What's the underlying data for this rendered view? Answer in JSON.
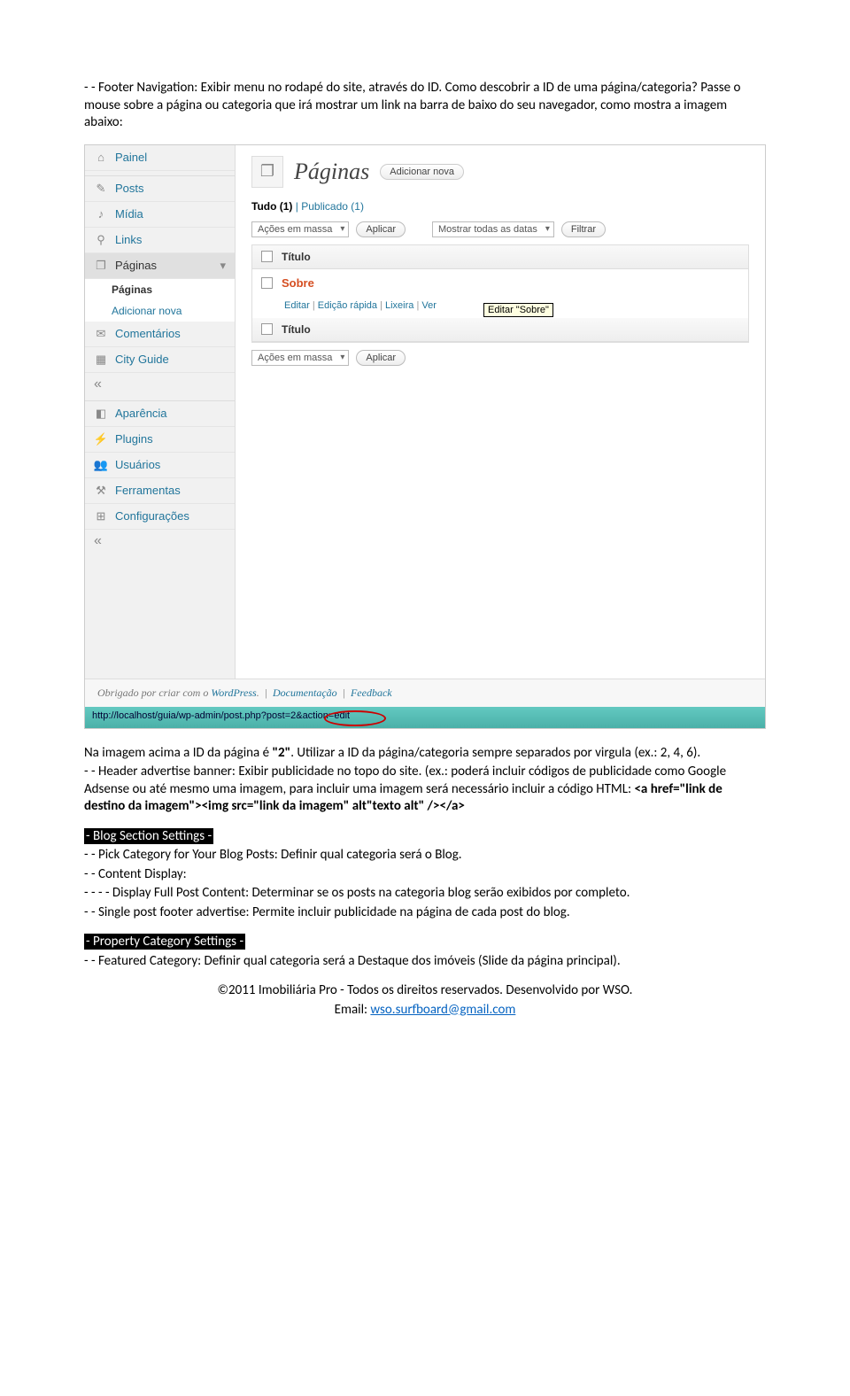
{
  "intro": {
    "line1": "- - Footer Navigation: Exibir menu no rodapé do site, através do ID. Como descobrir a ID de uma página/categoria? Passe o mouse sobre a página ou categoria que irá mostrar um link na barra de baixo do seu navegador, como mostra a imagem abaixo:"
  },
  "wp": {
    "sidebar": {
      "painel": "Painel",
      "posts": "Posts",
      "midia": "Mídia",
      "links": "Links",
      "paginas": "Páginas",
      "paginas_sub1": "Páginas",
      "paginas_sub2": "Adicionar nova",
      "comentarios": "Comentários",
      "cityguide": "City Guide",
      "aparencia": "Aparência",
      "plugins": "Plugins",
      "usuarios": "Usuários",
      "ferramentas": "Ferramentas",
      "configuracoes": "Configurações"
    },
    "main": {
      "title": "Páginas",
      "addnew": "Adicionar nova",
      "filter_all": "Tudo (1)",
      "filter_pub": "Publicado (1)",
      "bulk_actions": "Ações em massa",
      "apply": "Aplicar",
      "show_dates": "Mostrar todas as datas",
      "filter_btn": "Filtrar",
      "col_title": "Título",
      "row_title": "Sobre",
      "row_act_edit": "Editar",
      "row_act_quick": "Edição rápida",
      "row_act_trash": "Lixeira",
      "row_act_view": "Ver",
      "tooltip": "Editar \"Sobre\""
    },
    "footer": {
      "thanks": "Obrigado por criar com o ",
      "wp": "WordPress",
      "doc": "Documentação",
      "fb": "Feedback"
    },
    "status": "http://localhost/guia/wp-admin/post.php?post=2&action=edit"
  },
  "after": {
    "p1a": "Na imagem acima a ID da página é ",
    "p1b": "\"2\"",
    "p1c": ". Utilizar a ID da página/categoria sempre separados por virgula (ex.: 2, 4, 6).",
    "p2a": "- - Header advertise banner: Exibir publicidade no topo do site. (ex.: poderá incluir códigos de publicidade como Google Adsense ou até mesmo uma imagem, para incluir uma imagem será necessário incluir a código HTML: ",
    "p2b": "<a href=\"link de destino da imagem\"><img src=\"link da imagem\" alt\"texto alt\" /></a>"
  },
  "blog": {
    "heading": "- Blog Section Settings -",
    "l1": "- - Pick Category for Your Blog Posts: Definir qual categoria será o Blog.",
    "l2": "- - Content Display:",
    "l3": "- - - - Display Full Post Content: Determinar se os posts na categoria blog serão exibidos por completo.",
    "l4": "- - Single post footer advertise: Permite incluir publicidade na página de cada post do blog."
  },
  "prop": {
    "heading": "- Property Category Settings -",
    "l1": "- - Featured Category: Definir qual categoria será a Destaque dos imóveis (Slide da página principal)."
  },
  "footer": {
    "line1": "©2011 Imobiliária Pro - Todos os direitos reservados. Desenvolvido por WSO.",
    "line2a": "Email: ",
    "line2b": "wso.surfboard@gmail.com"
  }
}
